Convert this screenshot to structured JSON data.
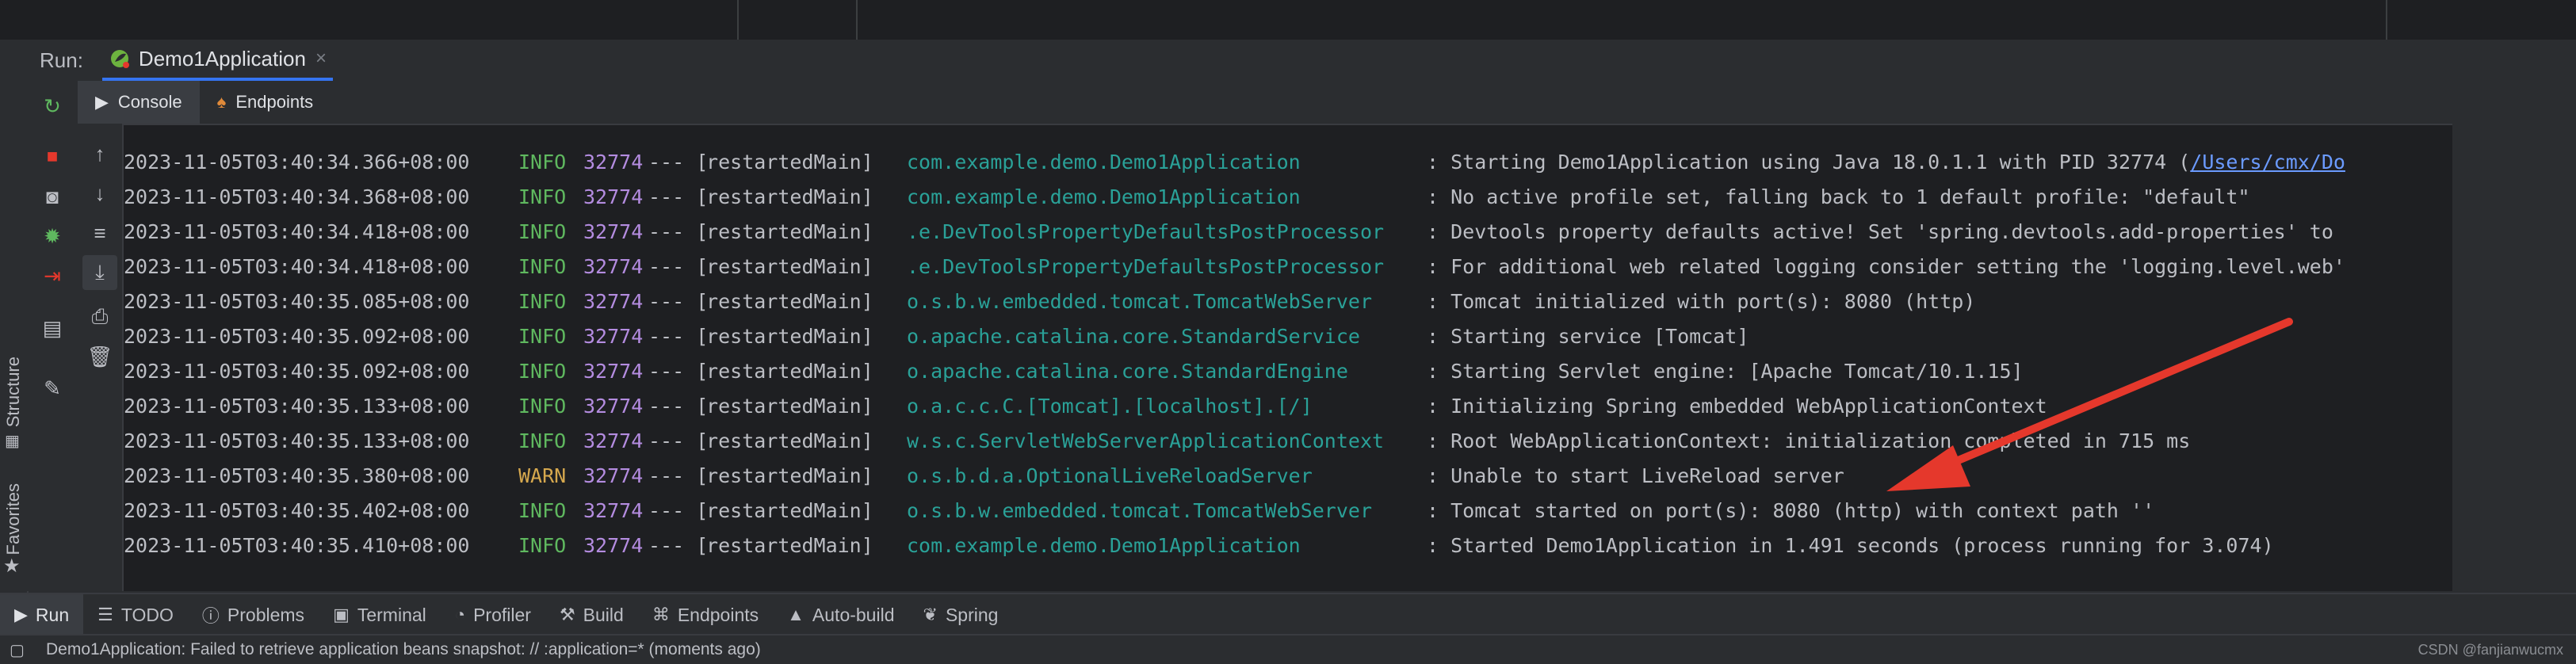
{
  "run": {
    "label": "Run:",
    "config_tab": "Demo1Application",
    "close": "×"
  },
  "subtabs": [
    {
      "label": "Console",
      "icon": "console-icon"
    },
    {
      "label": "Endpoints",
      "icon": "endpoints-icon"
    }
  ],
  "side_labels": {
    "structure": "Structure",
    "favorites": "Favorites"
  },
  "log_rows": [
    {
      "date": "2023-11-05T03:40:34.366+08:00",
      "level": "INFO",
      "pid": "32774",
      "sep": "--- [",
      "thread": " restartedMain]",
      "logger": "com.example.demo.Demo1Application",
      "msg": ": Starting Demo1Application using Java 18.0.1.1 with PID 32774 (",
      "link": "/Users/cmx/Do"
    },
    {
      "date": "2023-11-05T03:40:34.368+08:00",
      "level": "INFO",
      "pid": "32774",
      "sep": "--- [",
      "thread": " restartedMain]",
      "logger": "com.example.demo.Demo1Application",
      "msg": ": No active profile set, falling back to 1 default profile: \"default\""
    },
    {
      "date": "2023-11-05T03:40:34.418+08:00",
      "level": "INFO",
      "pid": "32774",
      "sep": "--- [",
      "thread": " restartedMain]",
      "logger": ".e.DevToolsPropertyDefaultsPostProcessor",
      "msg": ": Devtools property defaults active! Set 'spring.devtools.add-properties' to"
    },
    {
      "date": "2023-11-05T03:40:34.418+08:00",
      "level": "INFO",
      "pid": "32774",
      "sep": "--- [",
      "thread": " restartedMain]",
      "logger": ".e.DevToolsPropertyDefaultsPostProcessor",
      "msg": ": For additional web related logging consider setting the 'logging.level.web'"
    },
    {
      "date": "2023-11-05T03:40:35.085+08:00",
      "level": "INFO",
      "pid": "32774",
      "sep": "--- [",
      "thread": " restartedMain]",
      "logger": "o.s.b.w.embedded.tomcat.TomcatWebServer",
      "msg": ": Tomcat initialized with port(s): 8080 (http)"
    },
    {
      "date": "2023-11-05T03:40:35.092+08:00",
      "level": "INFO",
      "pid": "32774",
      "sep": "--- [",
      "thread": " restartedMain]",
      "logger": "o.apache.catalina.core.StandardService",
      "msg": ": Starting service [Tomcat]"
    },
    {
      "date": "2023-11-05T03:40:35.092+08:00",
      "level": "INFO",
      "pid": "32774",
      "sep": "--- [",
      "thread": " restartedMain]",
      "logger": "o.apache.catalina.core.StandardEngine",
      "msg": ": Starting Servlet engine: [Apache Tomcat/10.1.15]"
    },
    {
      "date": "2023-11-05T03:40:35.133+08:00",
      "level": "INFO",
      "pid": "32774",
      "sep": "--- [",
      "thread": " restartedMain]",
      "logger": "o.a.c.c.C.[Tomcat].[localhost].[/]",
      "msg": ": Initializing Spring embedded WebApplicationContext"
    },
    {
      "date": "2023-11-05T03:40:35.133+08:00",
      "level": "INFO",
      "pid": "32774",
      "sep": "--- [",
      "thread": " restartedMain]",
      "logger": "w.s.c.ServletWebServerApplicationContext",
      "msg": ": Root WebApplicationContext: initialization completed in 715 ms"
    },
    {
      "date": "2023-11-05T03:40:35.380+08:00",
      "level": "WARN",
      "pid": "32774",
      "sep": "--- [",
      "thread": " restartedMain]",
      "logger": "o.s.b.d.a.OptionalLiveReloadServer",
      "msg": ": Unable to start LiveReload server"
    },
    {
      "date": "2023-11-05T03:40:35.402+08:00",
      "level": "INFO",
      "pid": "32774",
      "sep": "--- [",
      "thread": " restartedMain]",
      "logger": "o.s.b.w.embedded.tomcat.TomcatWebServer",
      "msg": ": Tomcat started on port(s): 8080 (http) with context path ''"
    },
    {
      "date": "2023-11-05T03:40:35.410+08:00",
      "level": "INFO",
      "pid": "32774",
      "sep": "--- [",
      "thread": " restartedMain]",
      "logger": "com.example.demo.Demo1Application",
      "msg": ": Started Demo1Application in 1.491 seconds (process running for 3.074)"
    }
  ],
  "tool_windows": [
    {
      "label": "Run",
      "icon": "play-icon",
      "active": true
    },
    {
      "label": "TODO",
      "icon": "todo-icon"
    },
    {
      "label": "Problems",
      "icon": "problems-icon"
    },
    {
      "label": "Terminal",
      "icon": "terminal-icon"
    },
    {
      "label": "Profiler",
      "icon": "profiler-icon"
    },
    {
      "label": "Build",
      "icon": "hammer-icon"
    },
    {
      "label": "Endpoints",
      "icon": "endpoints-icon"
    },
    {
      "label": "Auto-build",
      "icon": "warning-icon"
    },
    {
      "label": "Spring",
      "icon": "spring-leaf-icon"
    }
  ],
  "status": {
    "message": "Demo1Application: Failed to retrieve application beans snapshot: // :application=* (moments ago)",
    "watermark": "CSDN @fanjianwucmx"
  },
  "colors": {
    "accent": "#3574f0",
    "info": "#5fb85f",
    "warn": "#d6a84e",
    "pid": "#b48ce0",
    "logger": "#2aa198",
    "arrow": "#e5382c"
  }
}
